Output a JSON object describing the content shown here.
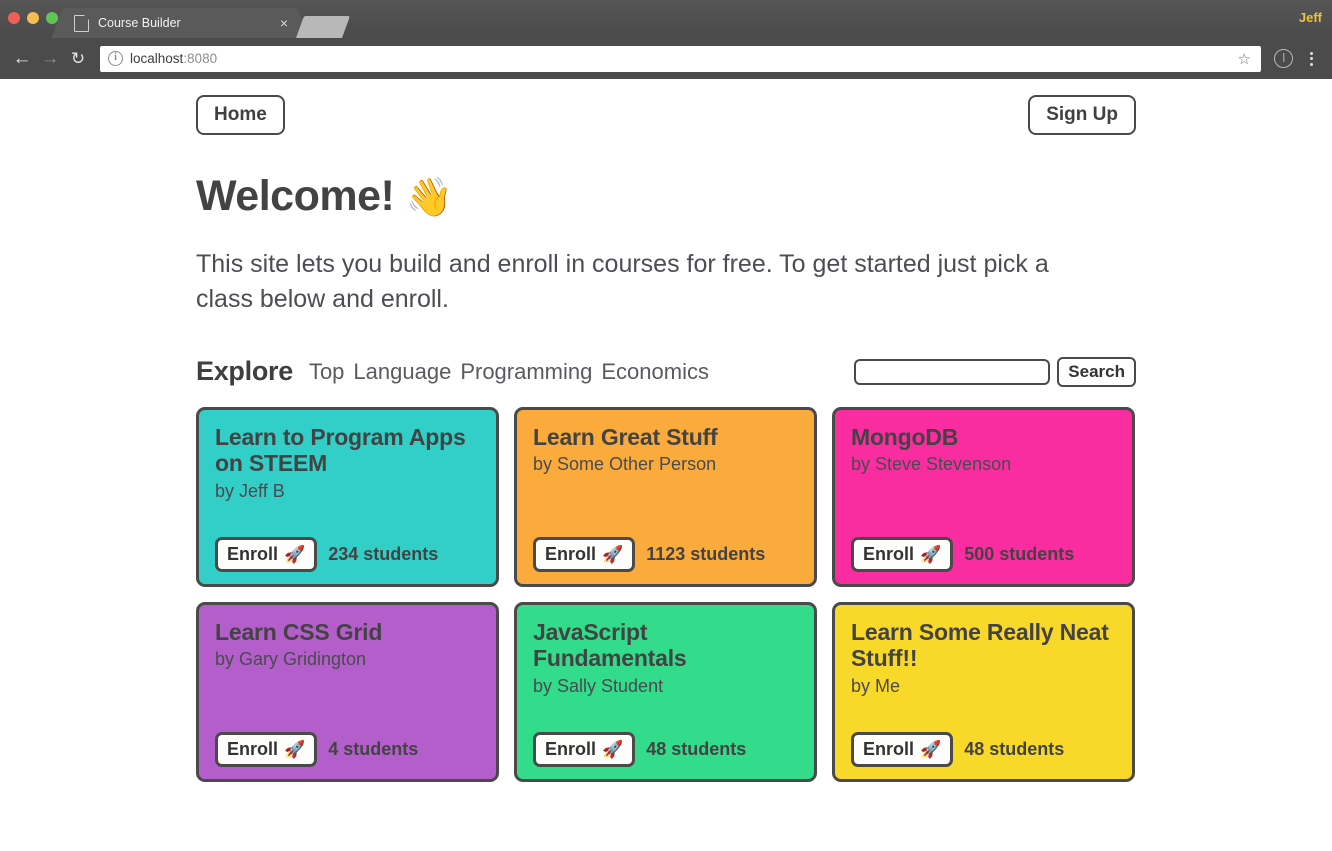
{
  "browser": {
    "tab_title": "Course Builder",
    "tab_close": "×",
    "profile_name": "Jeff",
    "back_icon": "←",
    "forward_icon": "→",
    "reload_icon": "↻",
    "info_icon": "i",
    "url_host": "localhost",
    "url_port": ":8080",
    "star_icon": "☆"
  },
  "header": {
    "home_label": "Home",
    "signup_label": "Sign Up"
  },
  "hero": {
    "title": "Welcome!",
    "wave_emoji": "👋",
    "intro": "This site lets you build and enroll in courses for free. To get started just pick a class below and enroll."
  },
  "explore": {
    "title": "Explore",
    "filters": [
      {
        "label": "Top"
      },
      {
        "label": "Language"
      },
      {
        "label": "Programming"
      },
      {
        "label": "Economics"
      }
    ],
    "search_value": "",
    "search_placeholder": "",
    "search_button_label": "Search"
  },
  "cards": [
    {
      "title": "Learn to Program Apps on STEEM",
      "author": "by Jeff B",
      "enroll_label": "Enroll",
      "rocket": "🚀",
      "students": "234 students",
      "color": "#32cfc9"
    },
    {
      "title": "Learn Great Stuff",
      "author": "by Some Other Person",
      "enroll_label": "Enroll",
      "rocket": "🚀",
      "students": "1123 students",
      "color": "#fbab3c"
    },
    {
      "title": "MongoDB",
      "author": "by Steve Stevenson",
      "enroll_label": "Enroll",
      "rocket": "🚀",
      "students": "500 students",
      "color": "#fa2da0"
    },
    {
      "title": "Learn CSS Grid",
      "author": "by Gary Gridington",
      "enroll_label": "Enroll",
      "rocket": "🚀",
      "students": "4 students",
      "color": "#b35ecb"
    },
    {
      "title": "JavaScript Fundamentals",
      "author": "by Sally Student",
      "enroll_label": "Enroll",
      "rocket": "🚀",
      "students": "48 students",
      "color": "#32dc8a"
    },
    {
      "title": "Learn Some Really Neat Stuff!!",
      "author": "by Me",
      "enroll_label": "Enroll",
      "rocket": "🚀",
      "students": "48 students",
      "color": "#f8d828"
    }
  ],
  "theme": {
    "border_color": "#4a4a4a",
    "text_color": "#434343"
  }
}
